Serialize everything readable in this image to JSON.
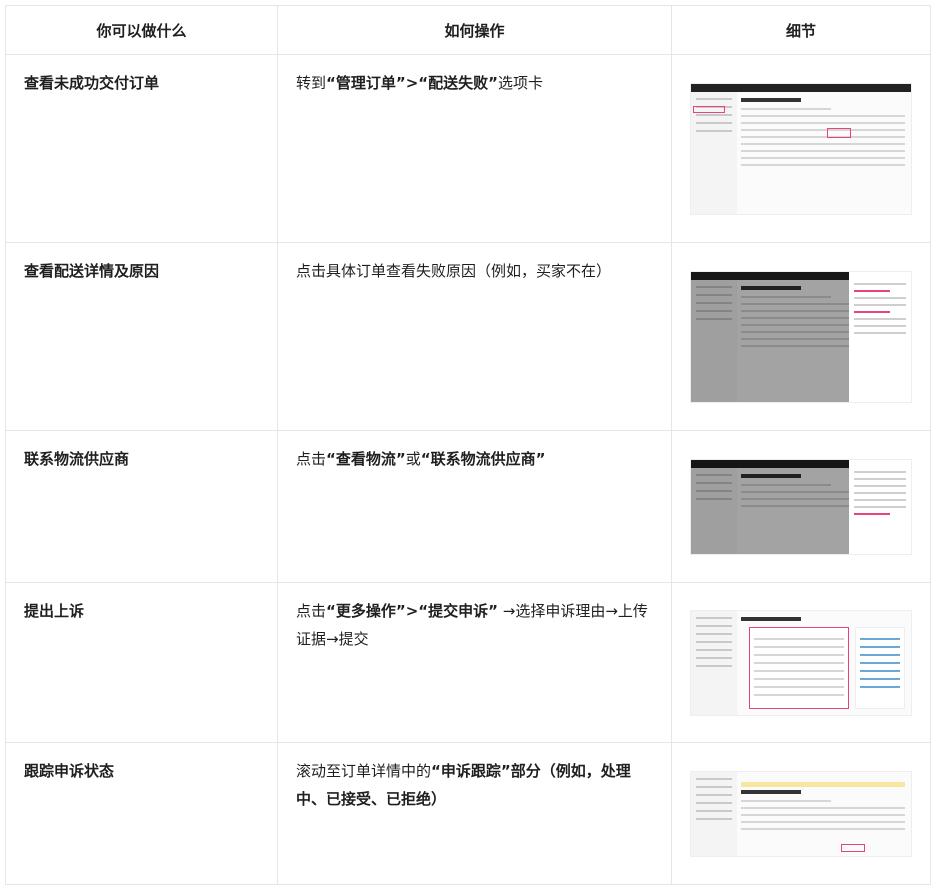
{
  "headers": [
    "你可以做什么",
    "如何操作",
    "细节"
  ],
  "rows": [
    {
      "task": "查看未成功交付订单",
      "steps_html": "转到<b>“管理订单”&gt;“配送失败”</b>选项卡",
      "detail_icon": "orders-list-screenshot"
    },
    {
      "task": "查看配送详情及原因",
      "steps_html": "点击具体订单查看失败原因（例如，买家不在）",
      "detail_icon": "delivery-detail-screenshot"
    },
    {
      "task": "联系物流供应商",
      "steps_html": "点击<b>“查看物流”</b>或<b>“联系物流供应商”</b>",
      "detail_icon": "logistics-panel-screenshot"
    },
    {
      "task": "提出上诉",
      "steps_html": "点击<b>“更多操作”&gt;“提交申诉”</b> →选择申诉理由→上传证据→提交",
      "detail_icon": "appeal-form-screenshot"
    },
    {
      "task": "跟踪申诉状态",
      "steps_html": "滚动至订单详情中的<b>“申诉跟踪”部分（例如，处理中、已接受、已拒绝）</b>",
      "detail_icon": "appeal-tracking-screenshot"
    }
  ],
  "colors": {
    "border": "#e6e6e6",
    "highlight": "#e8447a"
  }
}
